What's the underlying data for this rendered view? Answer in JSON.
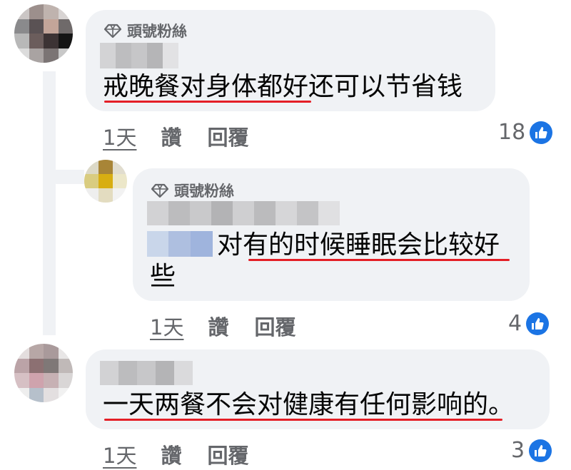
{
  "comments": [
    {
      "badge": "頭號粉絲",
      "text": "戒晚餐对身体都好还可以节省钱",
      "time": "1天",
      "like_label": "讚",
      "reply_label": "回覆",
      "reaction_count": "18"
    },
    {
      "badge": "頭號粉絲",
      "text_line1": "对有的时候睡眠会比较好",
      "text_line2": "些",
      "time": "1天",
      "like_label": "讚",
      "reply_label": "回覆",
      "reaction_count": "4"
    },
    {
      "text": "一天两餐不会对健康有任何影响的。",
      "time": "1天",
      "like_label": "讚",
      "reply_label": "回覆",
      "reaction_count": "3"
    }
  ],
  "colors": {
    "bubble": "#f0f2f5",
    "underline": "#e41e26",
    "like": "#1b74e4",
    "secondary_text": "#65676b"
  },
  "icons": {
    "badge": "diamond-icon",
    "reaction": "thumbs-up-icon"
  }
}
